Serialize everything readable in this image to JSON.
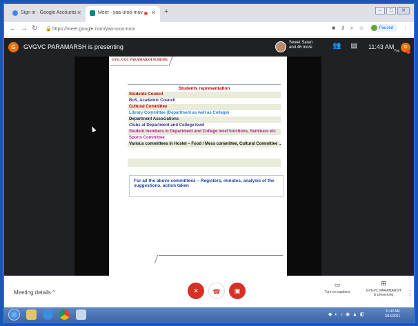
{
  "browser": {
    "tabs": [
      {
        "label": "Sign in - Google Accounts",
        "icon": "google-icon"
      },
      {
        "label": "Meet - yaa-uroo-mov",
        "icon": "meet-icon"
      }
    ],
    "new_tab": "+",
    "url": "https://meet.google.com/yaa-uroo-mov",
    "paused_label": "Paused"
  },
  "meet": {
    "presenter_initial": "G",
    "presenting_text": "GVGVC PARAMARSH is presenting",
    "participants_text": [
      "Sweet Saran",
      "and 46 more"
    ],
    "time": "11:43 AM",
    "you_label": "You",
    "you_initial": "G"
  },
  "slide": {
    "header": "GVG, UGC PARAMARSH SCHEME",
    "title": "Students representation",
    "rows": [
      {
        "text": "Students Council",
        "color": "#c00000"
      },
      {
        "text": "BoS, Academic Council",
        "color": "#2f2f9a"
      },
      {
        "text": "Cultural Committee",
        "color": "#c00000"
      },
      {
        "text": "Library Committee  (Department as well as College)",
        "color": "#2f7fd6"
      },
      {
        "text": "Department Associations",
        "color": "#1c2a6a"
      },
      {
        "text": "Clubs at Department and College level",
        "color": "#2f2f9a"
      },
      {
        "text": "Student members in Department and College level functions, Seminars etc",
        "color": "#b0209a"
      },
      {
        "text": "Sports Committee",
        "color": "#b0209a"
      },
      {
        "text": "Various committees in Hostel – Food / Mess committee, Cultural Committee .....",
        "color": "#111111"
      }
    ],
    "note": "For all the above committees – Registers, minutes, analysis of the suggestions, action taken"
  },
  "controls": {
    "meeting_details": "Meeting details",
    "captions": "Turn on captions",
    "present_line1": "GVGVC PARAMARSH",
    "present_line2": "is presenting"
  },
  "taskbar": {
    "time": "11:43 AM",
    "date": "3/16/2021"
  }
}
